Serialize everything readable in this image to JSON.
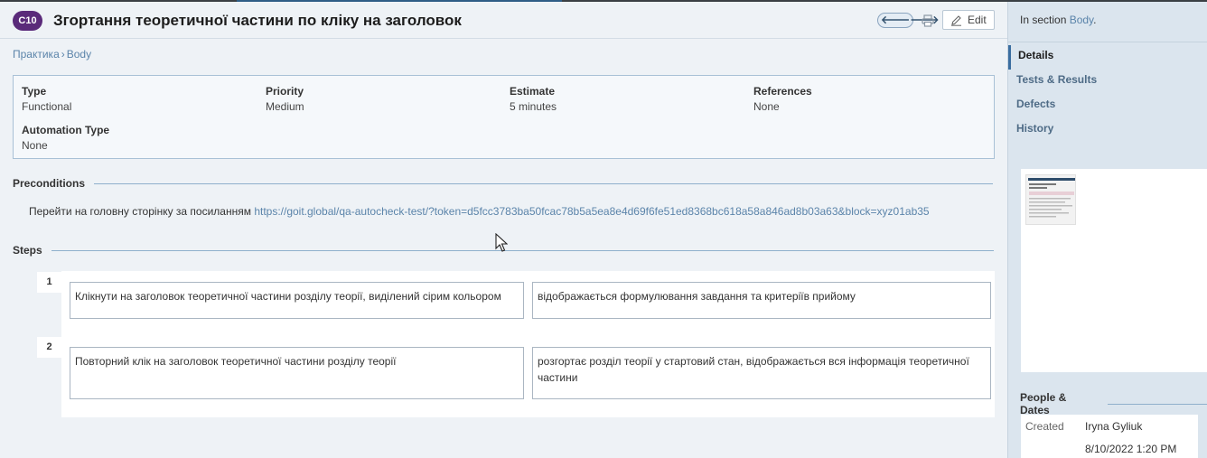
{
  "case": {
    "id": "C10",
    "title": "Згортання теоретичної частини по кліку на заголовок",
    "edit_label": "Edit"
  },
  "breadcrumb": {
    "parent": "Практика",
    "separator": "›",
    "current": "Body"
  },
  "properties": {
    "type": {
      "label": "Type",
      "value": "Functional"
    },
    "priority": {
      "label": "Priority",
      "value": "Medium"
    },
    "estimate": {
      "label": "Estimate",
      "value": "5 minutes"
    },
    "references": {
      "label": "References",
      "value": "None"
    },
    "automation_type": {
      "label": "Automation Type",
      "value": "None"
    }
  },
  "preconditions": {
    "heading": "Preconditions",
    "text": "Перейти на головну сторінку за посиланням ",
    "link": "https://goit.global/qa-autocheck-test/?token=d5fcc3783ba50fcac78b5a5ea8e4d69f6fe51ed8368bc618a58a846ad8b03a63&block=xyz01ab35"
  },
  "steps": {
    "heading": "Steps",
    "items": [
      {
        "number": "1",
        "action": "Клікнути на заголовок теоретичної частини розділу теорії, виділений сірим кольором",
        "expected": "відображається формулювання завдання та критеріїв прийому"
      },
      {
        "number": "2",
        "action": "Повторний клік на заголовок теоретичної частини розділу теорії",
        "expected": "розгортає розділ теорії у стартовий стан, відображається вся інформація теоретичної частини"
      }
    ]
  },
  "sidebar": {
    "section_prefix": "In section ",
    "section_link": "Body",
    "section_suffix": ".",
    "nav": [
      "Details",
      "Tests & Results",
      "Defects",
      "History"
    ],
    "people_heading": "People & Dates",
    "created_label": "Created",
    "created_by": "Iryna Gyliuk",
    "created_at": "8/10/2022 1:20 PM"
  },
  "colors": {
    "case_badge": "#5a2a7a",
    "link": "#5b84aa",
    "accent": "#3b6ea0"
  }
}
